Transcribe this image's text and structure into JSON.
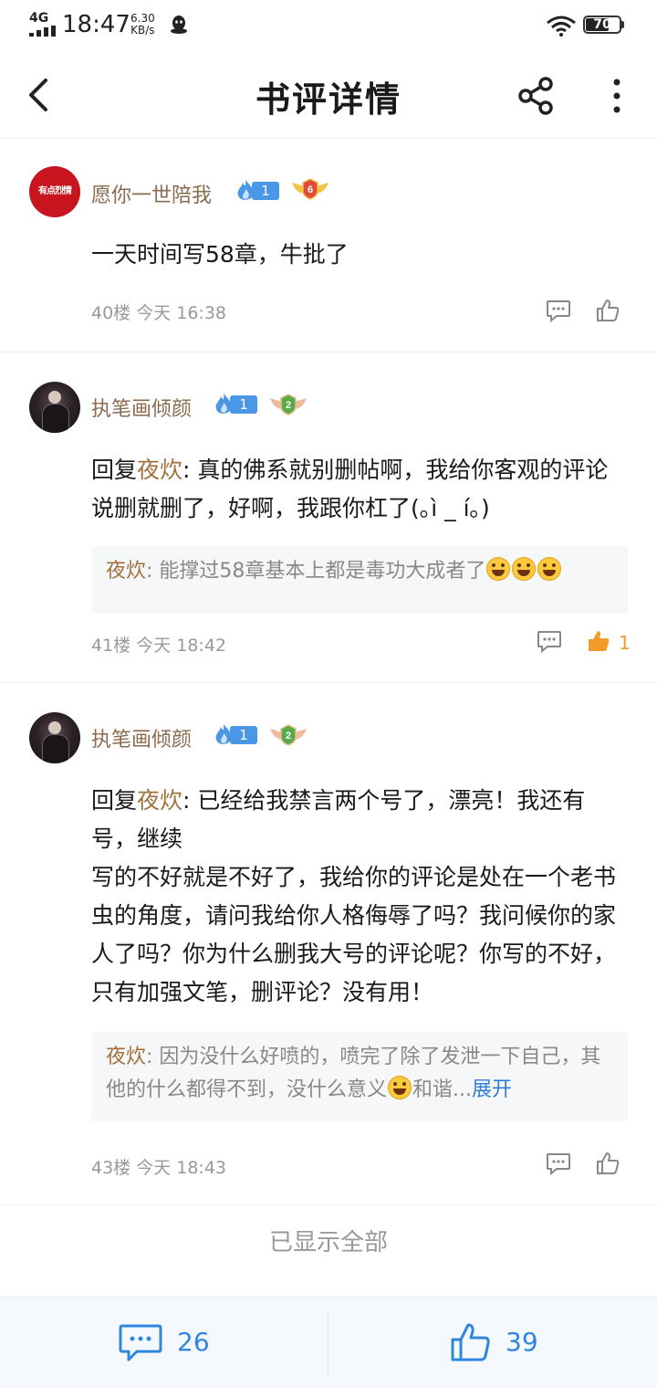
{
  "status_bar": {
    "network": "4G",
    "time": "18:47",
    "speed_value": "6.30",
    "speed_unit": "KB/s",
    "battery": "70",
    "battery_level": 0.7
  },
  "header": {
    "title": "书评详情"
  },
  "comments": [
    {
      "username": "愿你一世陪我",
      "avatar_text": "有点烈情",
      "level": "1",
      "rank": "6",
      "content": "一天时间写58章，牛批了",
      "floor_time": "40楼 今天 16:38"
    },
    {
      "username": "执笔画倾颜",
      "level": "1",
      "rank": "2",
      "reply_prefix": "回复",
      "reply_to": "夜炊",
      "content": ": 真的佛系就别删帖啊，我给你客观的评论说删就删了，好啊，我跟你杠了(｡ì _ í｡)",
      "quote_name": "夜炊",
      "quote_text": ": 能撑过58章基本上都是毒功大成者了",
      "floor_time": "41楼 今天 18:42",
      "likes": "1"
    },
    {
      "username": "执笔画倾颜",
      "level": "1",
      "rank": "2",
      "reply_prefix": "回复",
      "reply_to": "夜炊",
      "content_line1": ": 已经给我禁言两个号了，漂亮！我还有号，继续",
      "content_line2": "写的不好就是不好了，我给你的评论是处在一个老书虫的角度，请问我给你人格侮辱了吗？我问候你的家人了吗？你为什么删我大号的评论呢？你写的不好，只有加强文笔，删评论？没有用！",
      "quote_name": "夜炊",
      "quote_text": ": 因为没什么好喷的，喷完了除了发泄一下自己，其他的什么都得不到，没什么意义",
      "quote_tail": "和谐...",
      "expand": "展开",
      "floor_time": "43楼 今天 18:43"
    }
  ],
  "all_shown": "已显示全部",
  "bottom_bar": {
    "comment_count": "26",
    "like_count": "39"
  },
  "colors": {
    "username": "#8b6a4e",
    "reply_name": "#a0703a",
    "accent_blue": "#2e86de",
    "liked_orange": "#f39a2b"
  }
}
